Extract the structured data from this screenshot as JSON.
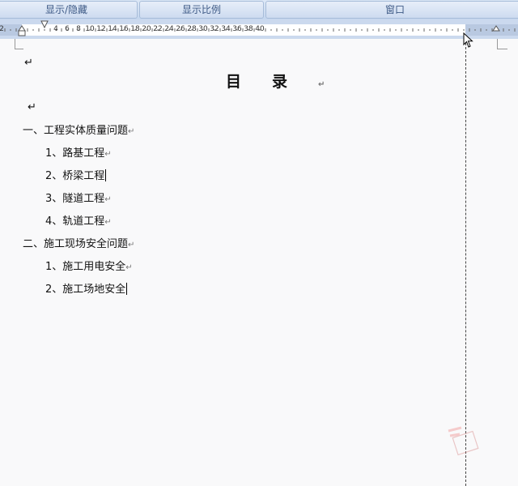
{
  "ribbon": {
    "groups": [
      "显示/隐藏",
      "显示比例",
      "窗口"
    ]
  },
  "ruler": {
    "labels": [
      "2",
      "2",
      "4",
      "6",
      "8",
      "10",
      "12",
      "14",
      "16",
      "18",
      "20",
      "22",
      "24",
      "26",
      "28",
      "30",
      "32",
      "34",
      "36",
      "38",
      "40"
    ]
  },
  "document": {
    "title": "目录",
    "paragraph_mark": "↵",
    "items": [
      "一、工程实体质量问题",
      "1、路基工程",
      "2、桥梁工程",
      "3、隧道工程",
      "4、轨道工程",
      "二、施工现场安全问题",
      "1、施工用电安全",
      "2、施工场地安全"
    ]
  },
  "colors": {
    "ribbon_text": "#3e5a86",
    "ruler_band": "#cbd9ee",
    "page_bg": "#f9f9fa"
  }
}
